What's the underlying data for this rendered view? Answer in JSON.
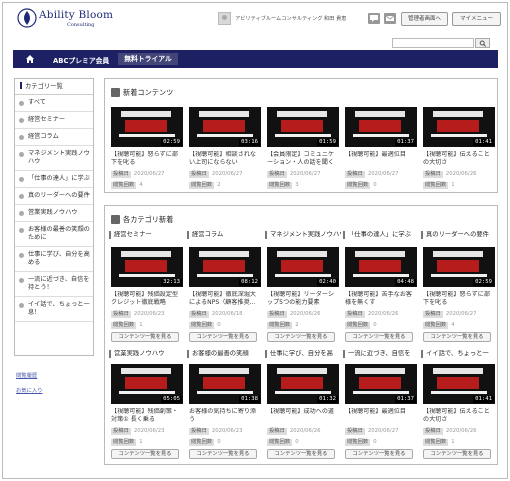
{
  "header": {
    "logo_text": "Ability Bloom",
    "logo_sub": "Consulting",
    "user_name": "アビリティブルームコンサルティング 和田 貴恵",
    "admin_button": "管理者画面へ",
    "mymenu_button": "マイメニュー"
  },
  "nav": {
    "items": [
      "ABCプレミア会員",
      "無料トライアル"
    ]
  },
  "sidebar": {
    "title": "カテゴリ一覧",
    "items": [
      "すべて",
      "経営セミナー",
      "経営コラム",
      "マネジメント実践ノウハウ",
      "「仕事の達人」に学ぶ",
      "真のリーダーへの要件",
      "営業実践ノウハウ",
      "お客様の最善の笑顔のために",
      "仕事に学び、自分を高める",
      "一流に近づき、自信を持とう！",
      "イイ話で、ちょっと一息！"
    ],
    "links": [
      "閲覧履歴",
      "お気に入り"
    ]
  },
  "new_contents": {
    "title": "新着コンテンツ",
    "cards": [
      {
        "title": "【視聴可能】怒らずに部下を叱る",
        "date": "2020/06/27",
        "views": "4",
        "duration": "02:59"
      },
      {
        "title": "【視聴可能】相談されない上司にならない",
        "date": "2020/06/27",
        "views": "2",
        "duration": "03:16"
      },
      {
        "title": "【会員限定】コミュニケーション・人の話を聞く",
        "date": "2020/06/27",
        "views": "3",
        "duration": "01:59"
      },
      {
        "title": "【視聴可能】最適位目",
        "date": "2020/06/27",
        "views": "0",
        "duration": "01:37"
      },
      {
        "title": "【視聴可能】伝えることの大切さ",
        "date": "2020/06/26",
        "views": "1",
        "duration": "01:41"
      }
    ]
  },
  "categories": {
    "title": "各カテゴリ新着",
    "more_label": "コンテンツ一覧を見る",
    "date_label": "投稿日",
    "views_label": "閲覧回数",
    "row1": [
      {
        "head": "経営セミナー",
        "title": "【視聴可能】残価設定型クレジット徹底戦略",
        "date": "2020/06/23",
        "views": "1",
        "duration": "32:13"
      },
      {
        "head": "経営コラム",
        "title": "【視聴可能】徹底深堀大によるNPS（顧客推奨…",
        "date": "2020/06/18",
        "views": "0",
        "duration": "08:12"
      },
      {
        "head": "マネジメント実践ノウハウ",
        "title": "【視聴可能】リーダーシップ5つの能力要素",
        "date": "2020/06/26",
        "views": "2",
        "duration": "02:40"
      },
      {
        "head": "「仕事の達人」に学ぶ",
        "title": "【視聴可能】苦手なお客様を無くす",
        "date": "2020/06/26",
        "views": "0",
        "duration": "04:48"
      },
      {
        "head": "真のリーダーへの要件",
        "title": "【視聴可能】怒らずに部下を叱る",
        "date": "2020/06/27",
        "views": "4",
        "duration": "02:59"
      }
    ],
    "row2": [
      {
        "head": "営業実践ノウハウ",
        "title": "【視聴可能】残価創策・対策① 長く乗る",
        "date": "2020/06/23",
        "views": "1",
        "duration": "05:05"
      },
      {
        "head": "お客様の最善の笑顔",
        "title": "お客様の気持ちに寄り添う",
        "date": "2020/06/23",
        "views": "0",
        "duration": "01:38"
      },
      {
        "head": "仕事に学び、自分を高",
        "title": "【視聴可能】成功への道",
        "date": "2020/06/26",
        "views": "0",
        "duration": "01:32"
      },
      {
        "head": "一流に近づき、自信を",
        "title": "【視聴可能】最適位目",
        "date": "2020/06/27",
        "views": "0",
        "duration": "01:37"
      },
      {
        "head": "イイ話で、ちょっと一",
        "title": "【視聴可能】伝えることの大切さ",
        "date": "2020/06/26",
        "views": "1",
        "duration": "01:41"
      }
    ]
  }
}
